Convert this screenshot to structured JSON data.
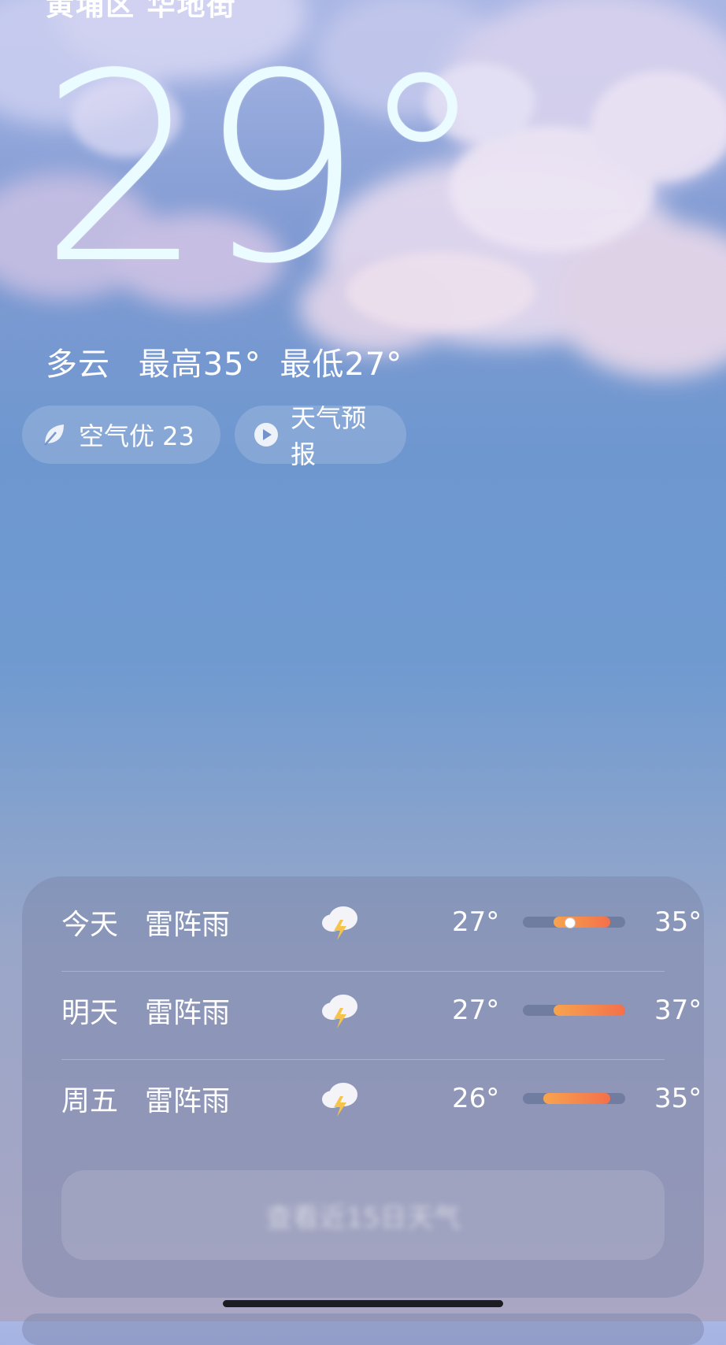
{
  "location": "黄埔区 华地街",
  "current": {
    "temperature": "29°",
    "condition": "多云",
    "high": "最高35°",
    "low": "最低27°"
  },
  "chips": {
    "air_quality": "空气优 23",
    "forecast": "天气预报"
  },
  "daily": [
    {
      "day": "今天",
      "condition": "雷阵雨",
      "icon": "thunderstorm-icon",
      "low": "27°",
      "high": "35°",
      "range_start": 0.3,
      "range_end": 0.85,
      "current_marker": 0.45
    },
    {
      "day": "明天",
      "condition": "雷阵雨",
      "icon": "thunderstorm-icon",
      "low": "27°",
      "high": "37°",
      "range_start": 0.3,
      "range_end": 1.0
    },
    {
      "day": "周五",
      "condition": "雷阵雨",
      "icon": "thunderstorm-icon",
      "low": "26°",
      "high": "35°",
      "range_start": 0.2,
      "range_end": 0.85
    }
  ],
  "more_button": "查看近15日天气",
  "colors": {
    "bar_start": "#f7a44f",
    "bar_end": "#f3704a",
    "temp_text": "#eafcff"
  }
}
